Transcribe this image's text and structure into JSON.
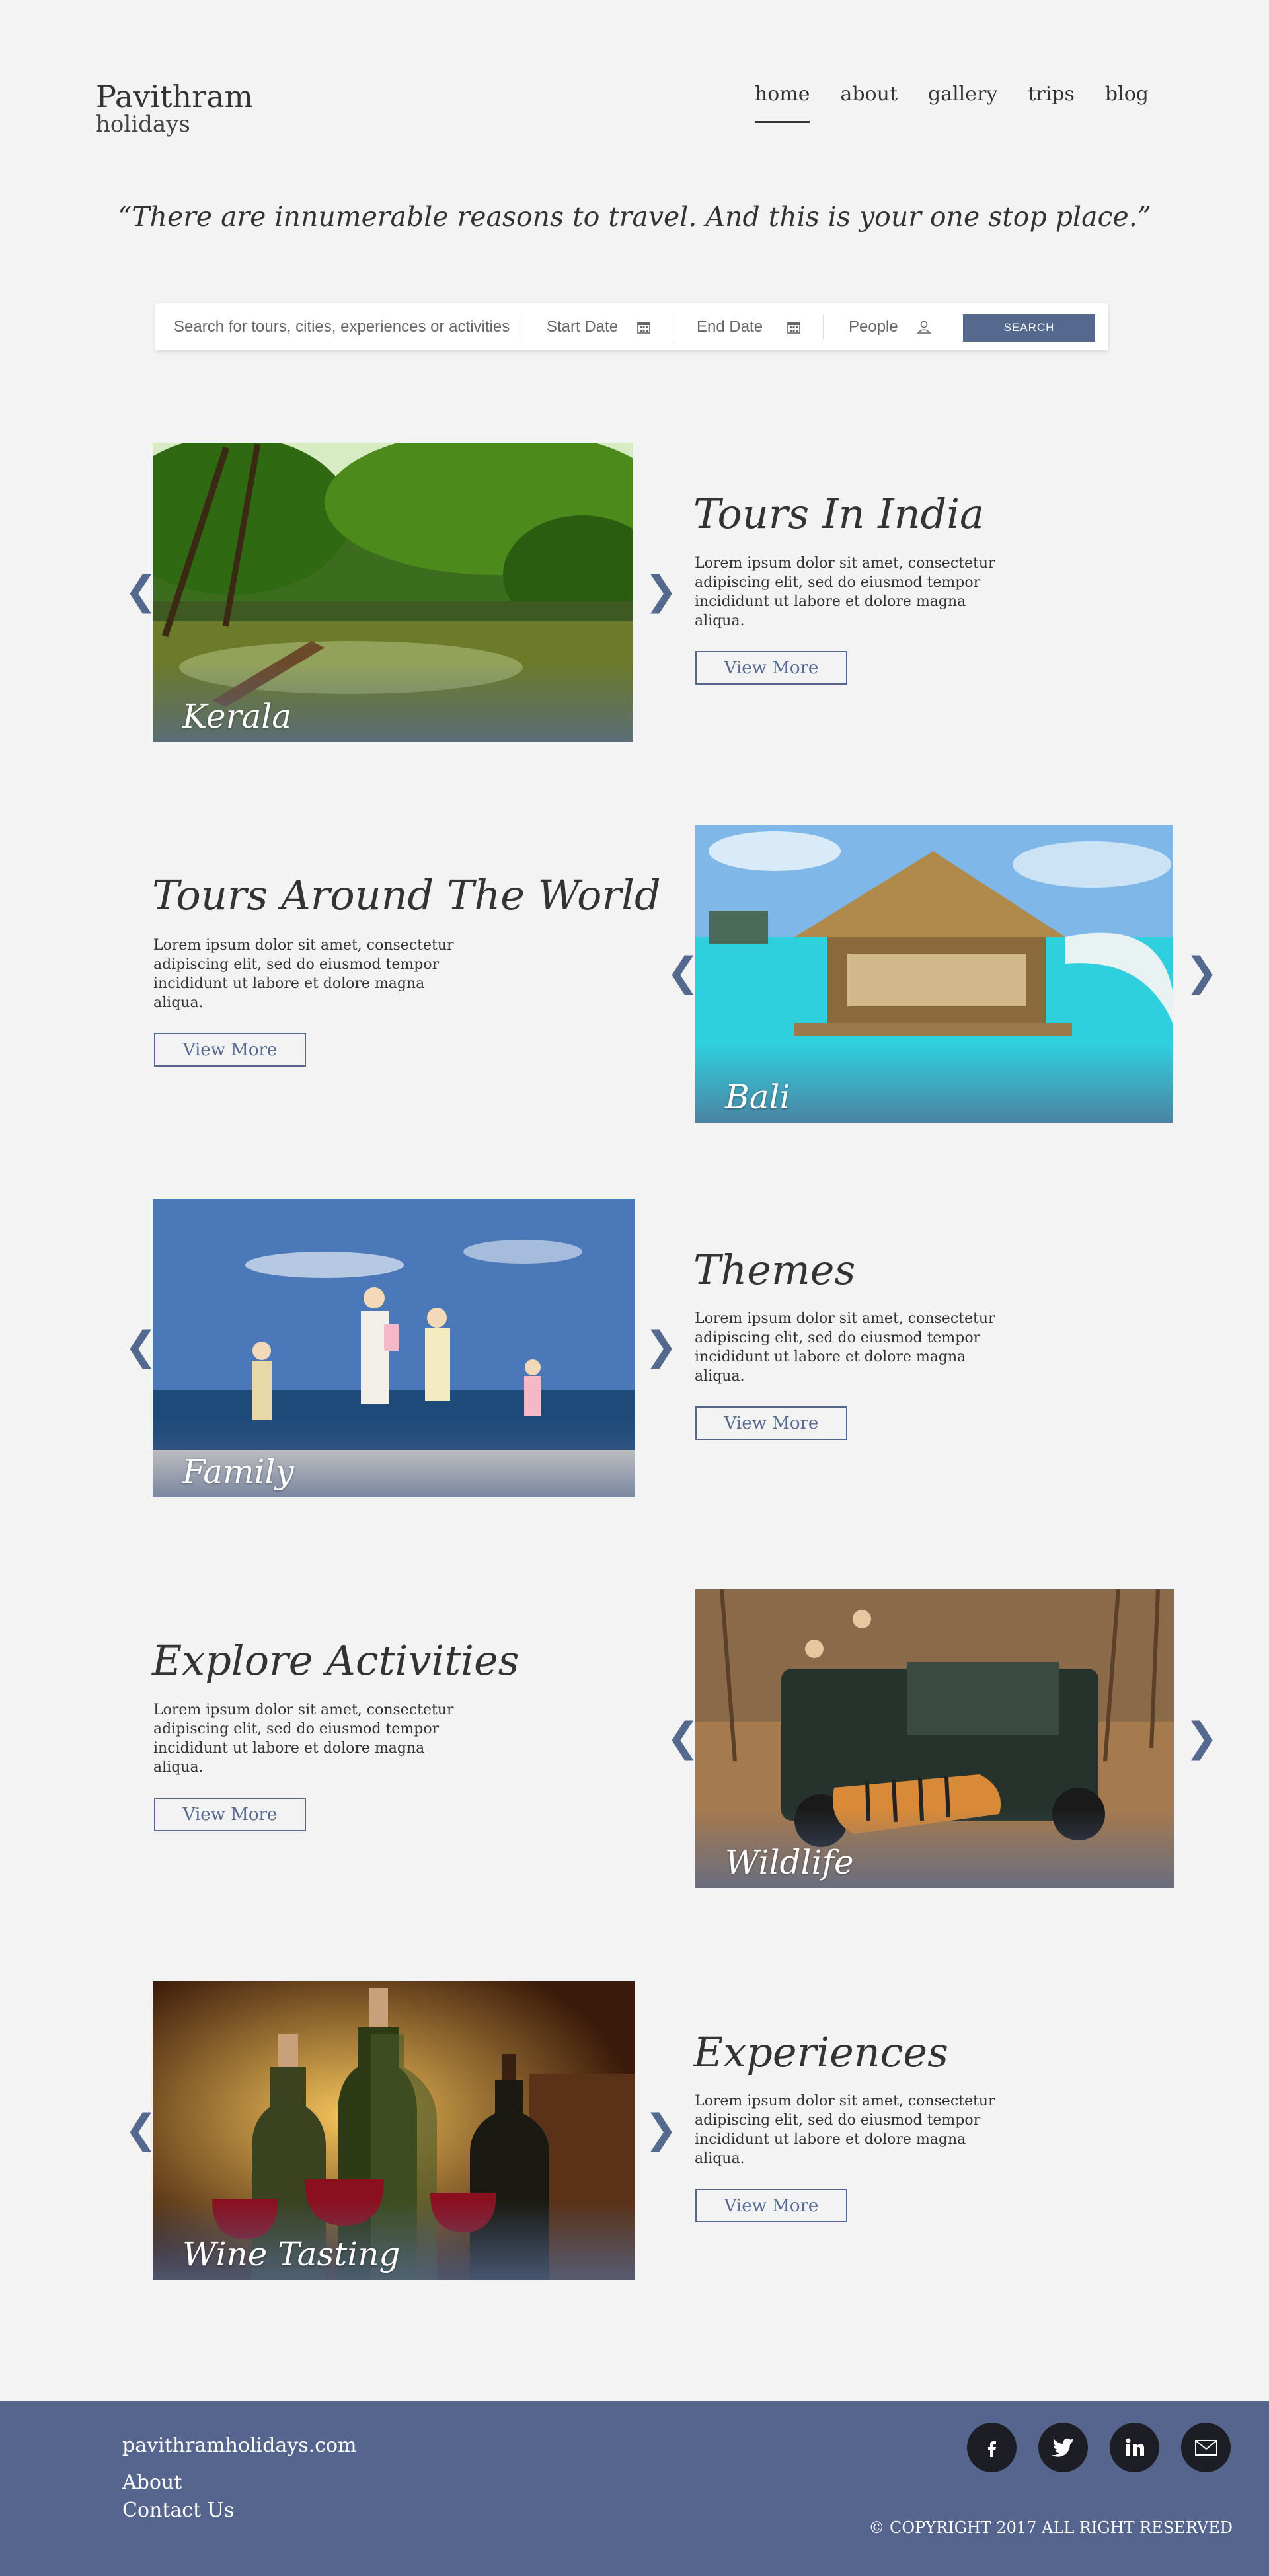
{
  "brand": {
    "line1": "Pavithram",
    "line2": "holidays"
  },
  "nav": {
    "items": [
      "home",
      "about",
      "gallery",
      "trips",
      "blog"
    ],
    "active": "home"
  },
  "quote": "“There are innumerable reasons to travel. And this is your one stop place.”",
  "search": {
    "placeholder": "Search for tours, cities, experiences or activities",
    "start_date": "Start Date",
    "end_date": "End Date",
    "people": "People",
    "button": "SEARCH"
  },
  "sections": [
    {
      "title": "Tours In India",
      "caption": "Kerala",
      "desc": "Lorem ipsum dolor sit amet, consectetur adipiscing elit, sed do eiusmod tempor incididunt ut labore et dolore magna aliqua.",
      "button": "View More"
    },
    {
      "title": "Tours Around The World",
      "caption": "Bali",
      "desc": "Lorem ipsum dolor sit amet, consectetur adipiscing elit, sed do eiusmod tempor incididunt ut labore et dolore magna aliqua.",
      "button": "View More"
    },
    {
      "title": "Themes",
      "caption": "Family",
      "desc": "Lorem ipsum dolor sit amet, consectetur adipiscing elit, sed do eiusmod tempor incididunt ut labore et dolore magna aliqua.",
      "button": "View More"
    },
    {
      "title": "Explore Activities",
      "caption": "Wildlife",
      "desc": "Lorem ipsum dolor sit amet, consectetur adipiscing elit, sed do eiusmod tempor incididunt ut labore et dolore magna aliqua.",
      "button": "View More"
    },
    {
      "title": "Experiences",
      "caption": "Wine Tasting",
      "desc": "Lorem ipsum dolor sit amet, consectetur adipiscing elit, sed do eiusmod tempor incididunt ut labore et dolore magna aliqua.",
      "button": "View More"
    }
  ],
  "arrows": {
    "prev": "❮",
    "next": "❯"
  },
  "footer": {
    "site": "pavithramholidays.com",
    "links": [
      "About",
      "Contact Us"
    ],
    "social": [
      "facebook-icon",
      "twitter-icon",
      "linkedin-icon",
      "mail-icon"
    ],
    "copyright": "© COPYRIGHT 2017 ALL RIGHT RESERVED"
  },
  "colors": {
    "accent": "#55698f",
    "footer": "#55658e",
    "background": "#f3f3f3"
  }
}
